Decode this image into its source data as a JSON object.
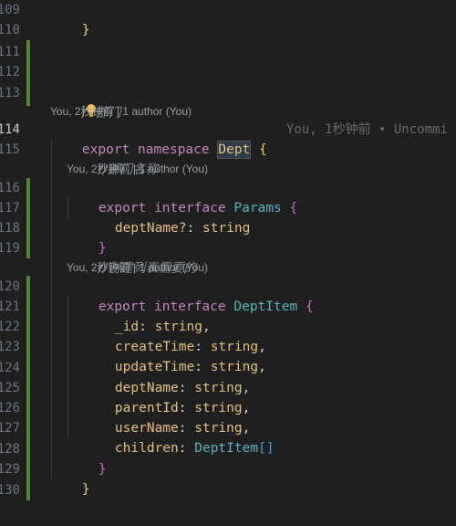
{
  "editor": {
    "line_numbers": [
      "109",
      "110",
      "111",
      "112",
      "113",
      "114",
      "115",
      "116",
      "117",
      "118",
      "119",
      "120",
      "121",
      "122",
      "123",
      "124",
      "125",
      "126",
      "127",
      "128",
      "129",
      "130"
    ],
    "active_line": "114",
    "code": {
      "l109_close": "}",
      "l113_comment_prefix": "/",
      "l113_comment_text": "部门",
      "l114_export": "export",
      "l114_namespace": "namespace",
      "l114_name": "Dept",
      "l114_brace": "{",
      "l115_comment": "//部门名称",
      "l116_export": "export",
      "l116_interface": "interface",
      "l116_name": "Params",
      "l116_brace": "{",
      "l117_prop": "deptName?",
      "l117_colon": ":",
      "l117_type": "string",
      "l118_close": "}",
      "l119_comment": "//创建列表需要的",
      "l120_export": "export",
      "l120_interface": "interface",
      "l120_name": "DeptItem",
      "l120_brace": "{",
      "fields": [
        {
          "name": "_id",
          "type": "string",
          "sep": ","
        },
        {
          "name": "createTime",
          "type": "string",
          "sep": ","
        },
        {
          "name": "updateTime",
          "type": "string",
          "sep": ","
        },
        {
          "name": "deptName",
          "type": "string",
          "sep": ","
        },
        {
          "name": "parentId",
          "type": "string",
          "sep": ","
        },
        {
          "name": "userName",
          "type": "string",
          "sep": ","
        }
      ],
      "l127_prop": "children",
      "l127_type": "DeptItem",
      "l127_brackets": "[]",
      "l128_close": "}",
      "l129_close": "}"
    },
    "blame": {
      "above_114": "You, 2秒钟前 | 1 author (You)",
      "above_116": "You, 2秒钟前 | 1 author (You)",
      "above_120": "You, 2秒钟前 | 1 author (You)",
      "inline_114": "You, 1秒钟前 • Uncommi"
    }
  },
  "colors": {
    "background": "#1f1f1f",
    "change_bar": "#4b8a2b",
    "keyword": "#c586c0",
    "type_name": "#56b6c2",
    "identifier": "#e5c07b",
    "comment": "#7f848e",
    "lightbulb": "#f6c343"
  },
  "icons": [
    "lightbulb-icon"
  ]
}
